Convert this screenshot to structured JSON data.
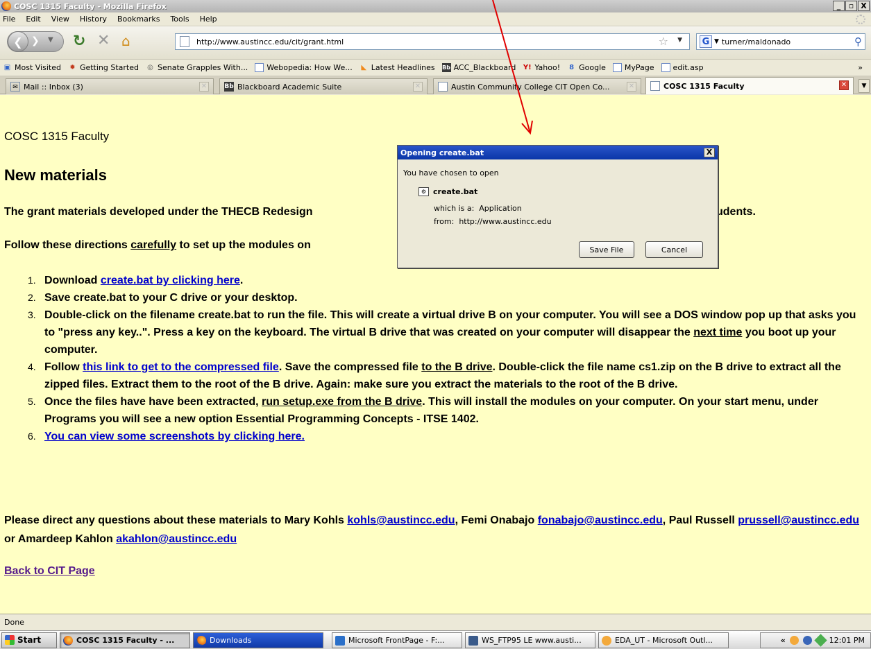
{
  "window": {
    "title": "COSC 1315 Faculty - Mozilla Firefox",
    "controls": [
      "_",
      "▫",
      "X"
    ]
  },
  "menu": [
    "File",
    "Edit",
    "View",
    "History",
    "Bookmarks",
    "Tools",
    "Help"
  ],
  "nav": {
    "url": "http://www.austincc.edu/cit/grant.html",
    "search_value": "turner/maldonado"
  },
  "bookmarks": [
    {
      "label": "Most Visited",
      "icon": "most-visited-icon",
      "color": "#2f62c8"
    },
    {
      "label": "Getting Started",
      "icon": "firefox-icon",
      "color": "#c23b1c"
    },
    {
      "label": "Senate Grapples With...",
      "icon": "globe-icon",
      "color": "#555555"
    },
    {
      "label": "Webopedia: How We...",
      "icon": "page-icon",
      "color": "#6b88c4"
    },
    {
      "label": "Latest Headlines",
      "icon": "rss-icon",
      "color": "#f08a1c"
    },
    {
      "label": "ACC_Blackboard",
      "icon": "blackboard-icon",
      "color": "#3a3a3a"
    },
    {
      "label": "Yahoo!",
      "icon": "yahoo-icon",
      "color": "#cc0000"
    },
    {
      "label": "Google",
      "icon": "google-icon",
      "color": "#3366cc"
    },
    {
      "label": "MyPage",
      "icon": "page-icon",
      "color": "#6b88c4"
    },
    {
      "label": "edit.asp",
      "icon": "page-icon",
      "color": "#6b88c4"
    }
  ],
  "bookmarks_more": "»",
  "tabs": [
    {
      "label": "Mail :: Inbox (3)",
      "icon": "mail-icon",
      "active": false
    },
    {
      "label": "Blackboard Academic Suite",
      "icon": "blackboard-icon",
      "active": false
    },
    {
      "label": "Austin Community College CIT Open Co...",
      "icon": "page-icon",
      "active": false
    },
    {
      "label": "COSC 1315 Faculty",
      "icon": "page-icon",
      "active": true
    }
  ],
  "page": {
    "title": "COSC 1315 Faculty",
    "heading": "New materials",
    "intro": "The grant materials developed under the THECB Redesign",
    "intro_tail": "udents.",
    "directions_pre": "Follow these directions ",
    "directions_em": "carefully",
    "directions_post": " to set up the modules on",
    "steps": [
      {
        "n": "1.",
        "pre": "Download ",
        "link": "create.bat by clicking here",
        "post": "."
      },
      {
        "n": "2.",
        "text": "Save create.bat to your C drive or your desktop."
      },
      {
        "n": "3.",
        "text": "Double-click on the filename create.bat to run the file. This will create a virtual drive B on your computer.  You will see a DOS window pop up that asks you to \"press any key..\". Press a key on the keyboard.  The virtual B drive that was created on your computer will disappear the ",
        "underlined": "next time",
        "post": " you boot up your computer."
      },
      {
        "n": "4.",
        "pre": "Follow ",
        "link": "this link to get to the compressed file",
        "mid": ". Save the compressed file ",
        "strong": "to the B drive",
        "post": ". Double-click the file name cs1.zip on the B drive to extract all the zipped files. Extract them to the root of the B drive. Again: make sure you extract the materials to the root of the B drive."
      },
      {
        "n": "5.",
        "pre": "Once the files have have been extracted, ",
        "underlined": "run setup.exe from the B drive",
        "post": ". This will install the modules on your computer. On your start menu, under Programs you will see a new option Essential Programming Concepts - ITSE 1402."
      },
      {
        "n": "6.",
        "link": "You can view some screenshots by clicking here."
      }
    ],
    "contact_pre": "Please direct any questions about these materials to Mary Kohls ",
    "contacts": [
      {
        "email": "kohls@austincc.edu",
        "after": ", Femi Onabajo "
      },
      {
        "email": "fonabajo@austincc.edu",
        "after": ", Paul Russell "
      },
      {
        "email": "prussell@austincc.edu",
        "after": " or Amardeep Kahlon "
      },
      {
        "email": "akahlon@austincc.edu",
        "after": ""
      }
    ],
    "back_link": "Back to CIT Page"
  },
  "dialog": {
    "title": "Opening create.bat",
    "line1": "You have chosen to open",
    "filename": "create.bat",
    "type_label": "which is a:",
    "type_value": "Application",
    "from_label": "from:",
    "from_value": "http://www.austincc.edu",
    "save_button": "Save File",
    "cancel_button": "Cancel",
    "close": "X"
  },
  "status": "Done",
  "taskbar": {
    "start": "Start",
    "items": [
      {
        "label": "COSC 1315 Faculty - ...",
        "icon": "firefox-icon"
      },
      {
        "label": "Downloads",
        "icon": "firefox-icon"
      },
      {
        "label": "Microsoft FrontPage - F:...",
        "icon": "frontpage-icon"
      },
      {
        "label": "WS_FTP95 LE www.austi...",
        "icon": "ftp-icon"
      },
      {
        "label": "EDA_UT - Microsoft Outl...",
        "icon": "outlook-icon"
      }
    ],
    "tray_chevron": "«",
    "clock": "12:01 PM"
  },
  "annotation_color": "#e00000"
}
